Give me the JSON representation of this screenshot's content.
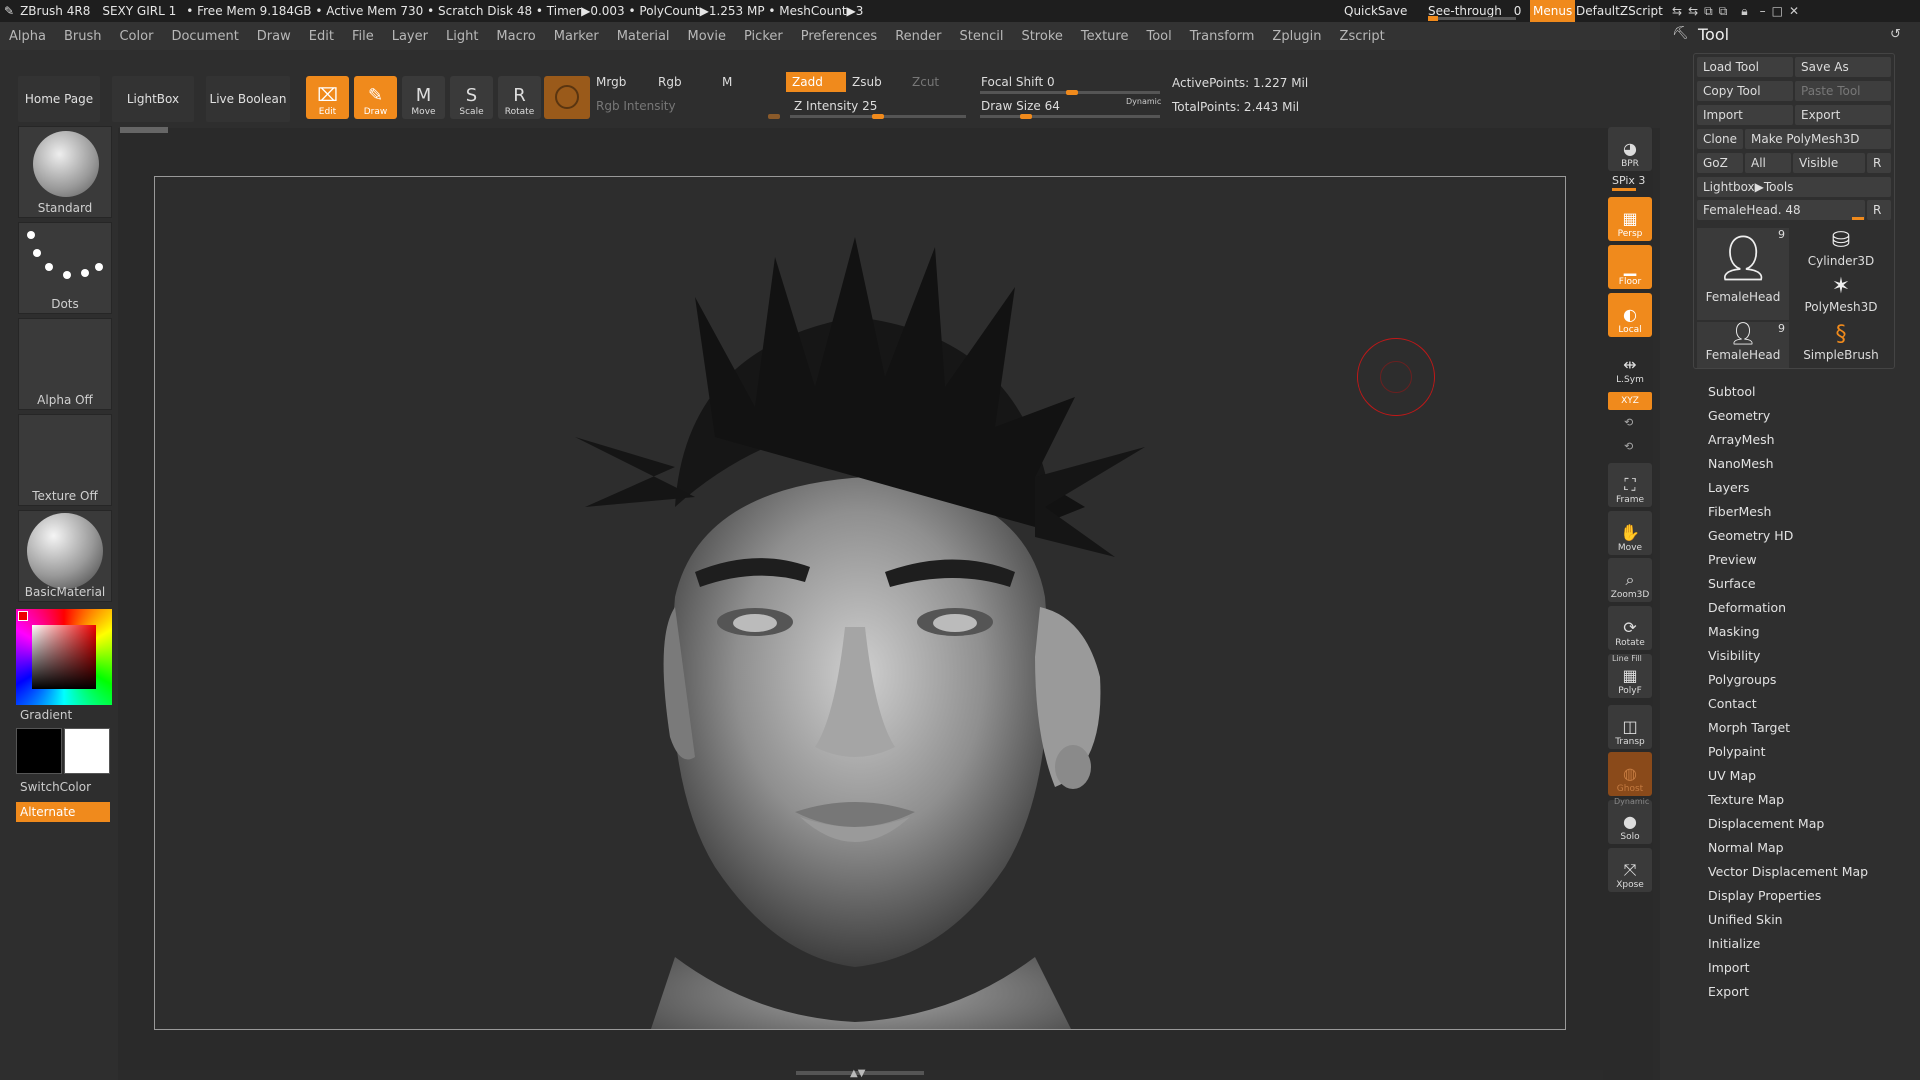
{
  "title_bar": {
    "app": "ZBrush 4R8",
    "doc": "SEXY GIRL 1",
    "stats": "• Free Mem 9.184GB • Active Mem 730 • Scratch Disk 48 • Timer▶0.003 • PolyCount▶1.253 MP • MeshCount▶3",
    "quicksave": "QuickSave",
    "see_through": "See-through",
    "see_through_value": "0",
    "menus": "Menus",
    "script": "DefaultZScript"
  },
  "menu": [
    "Alpha",
    "Brush",
    "Color",
    "Document",
    "Draw",
    "Edit",
    "File",
    "Layer",
    "Light",
    "Macro",
    "Marker",
    "Material",
    "Movie",
    "Picker",
    "Preferences",
    "Render",
    "Stencil",
    "Stroke",
    "Texture",
    "Tool",
    "Transform",
    "Zplugin",
    "Zscript"
  ],
  "toolbar": {
    "home": "Home Page",
    "lightbox": "LightBox",
    "live_boolean": "Live Boolean",
    "modes": [
      {
        "label": "Edit",
        "icon": "⌧",
        "active": true
      },
      {
        "label": "Draw",
        "icon": "✎",
        "active": true
      },
      {
        "label": "Move",
        "icon": "M",
        "active": false
      },
      {
        "label": "Scale",
        "icon": "S",
        "active": false
      },
      {
        "label": "Rotate",
        "icon": "R",
        "active": false
      }
    ],
    "mrgb": "Mrgb",
    "rgb": "Rgb",
    "m": "M",
    "zadd": "Zadd",
    "zsub": "Zsub",
    "zcut": "Zcut",
    "rgb_intensity": "Rgb Intensity",
    "z_intensity": "Z Intensity 25",
    "focal_shift": "Focal Shift 0",
    "draw_size": "Draw Size 64",
    "dynamic": "Dynamic",
    "active_points": "ActivePoints: 1.227 Mil",
    "total_points": "TotalPoints: 2.443 Mil"
  },
  "left_panel": {
    "brush": "Standard",
    "stroke": "Dots",
    "alpha": "Alpha Off",
    "texture": "Texture Off",
    "material": "BasicMaterial",
    "gradient": "Gradient",
    "switch_color": "SwitchColor",
    "alternate": "Alternate"
  },
  "right_shelf": {
    "bpr": "BPR",
    "spix": "SPix 3",
    "buttons": [
      {
        "label": "Persp",
        "icon": "▦",
        "active": true
      },
      {
        "label": "Floor",
        "icon": "▁",
        "active": true
      },
      {
        "label": "Local",
        "icon": "◐",
        "active": true
      },
      {
        "label": "L.Sym",
        "icon": "⇹",
        "active": false
      },
      {
        "label": "Frame",
        "icon": "⛶",
        "active": false
      },
      {
        "label": "Move",
        "icon": "✋",
        "active": false
      },
      {
        "label": "Zoom3D",
        "icon": "⌕",
        "active": false
      },
      {
        "label": "Rotate",
        "icon": "⟳",
        "active": false
      },
      {
        "label": "PolyF",
        "icon": "▦",
        "active": false
      },
      {
        "label": "Transp",
        "icon": "◫",
        "active": false
      },
      {
        "label": "Ghost",
        "icon": "◍",
        "active": true
      },
      {
        "label": "Solo",
        "icon": "●",
        "active": false
      },
      {
        "label": "Xpose",
        "icon": "⤧",
        "active": false
      }
    ],
    "xyz": "XYZ",
    "dynamic": "Dynamic",
    "line_fill": "Line Fill"
  },
  "tool_panel": {
    "title": "Tool",
    "load_tool": "Load Tool",
    "save_as": "Save As",
    "copy_tool": "Copy Tool",
    "paste_tool": "Paste Tool",
    "import": "Import",
    "export": "Export",
    "clone": "Clone",
    "make_polymesh": "Make PolyMesh3D",
    "goz": "GoZ",
    "all": "All",
    "visible": "Visible",
    "r": "R",
    "lightbox_tools": "Lightbox▶Tools",
    "current_tool": "FemaleHead. 48",
    "thumbs": [
      {
        "label": "FemaleHead",
        "badge": "9"
      },
      {
        "label": "Cylinder3D",
        "badge": ""
      },
      {
        "label": "PolyMesh3D",
        "badge": ""
      },
      {
        "label": "FemaleHead",
        "badge": "9"
      },
      {
        "label": "SimpleBrush",
        "badge": ""
      }
    ],
    "subpalettes": [
      "Subtool",
      "Geometry",
      "ArrayMesh",
      "NanoMesh",
      "Layers",
      "FiberMesh",
      "Geometry HD",
      "Preview",
      "Surface",
      "Deformation",
      "Masking",
      "Visibility",
      "Polygroups",
      "Contact",
      "Morph Target",
      "Polypaint",
      "UV Map",
      "Texture Map",
      "Displacement Map",
      "Normal Map",
      "Vector Displacement Map",
      "Display Properties",
      "Unified Skin",
      "Initialize",
      "Import",
      "Export"
    ]
  },
  "colors": {
    "accent": "#f08a1c",
    "bg": "#2b2b2b",
    "panel": "#2f2f2f"
  }
}
